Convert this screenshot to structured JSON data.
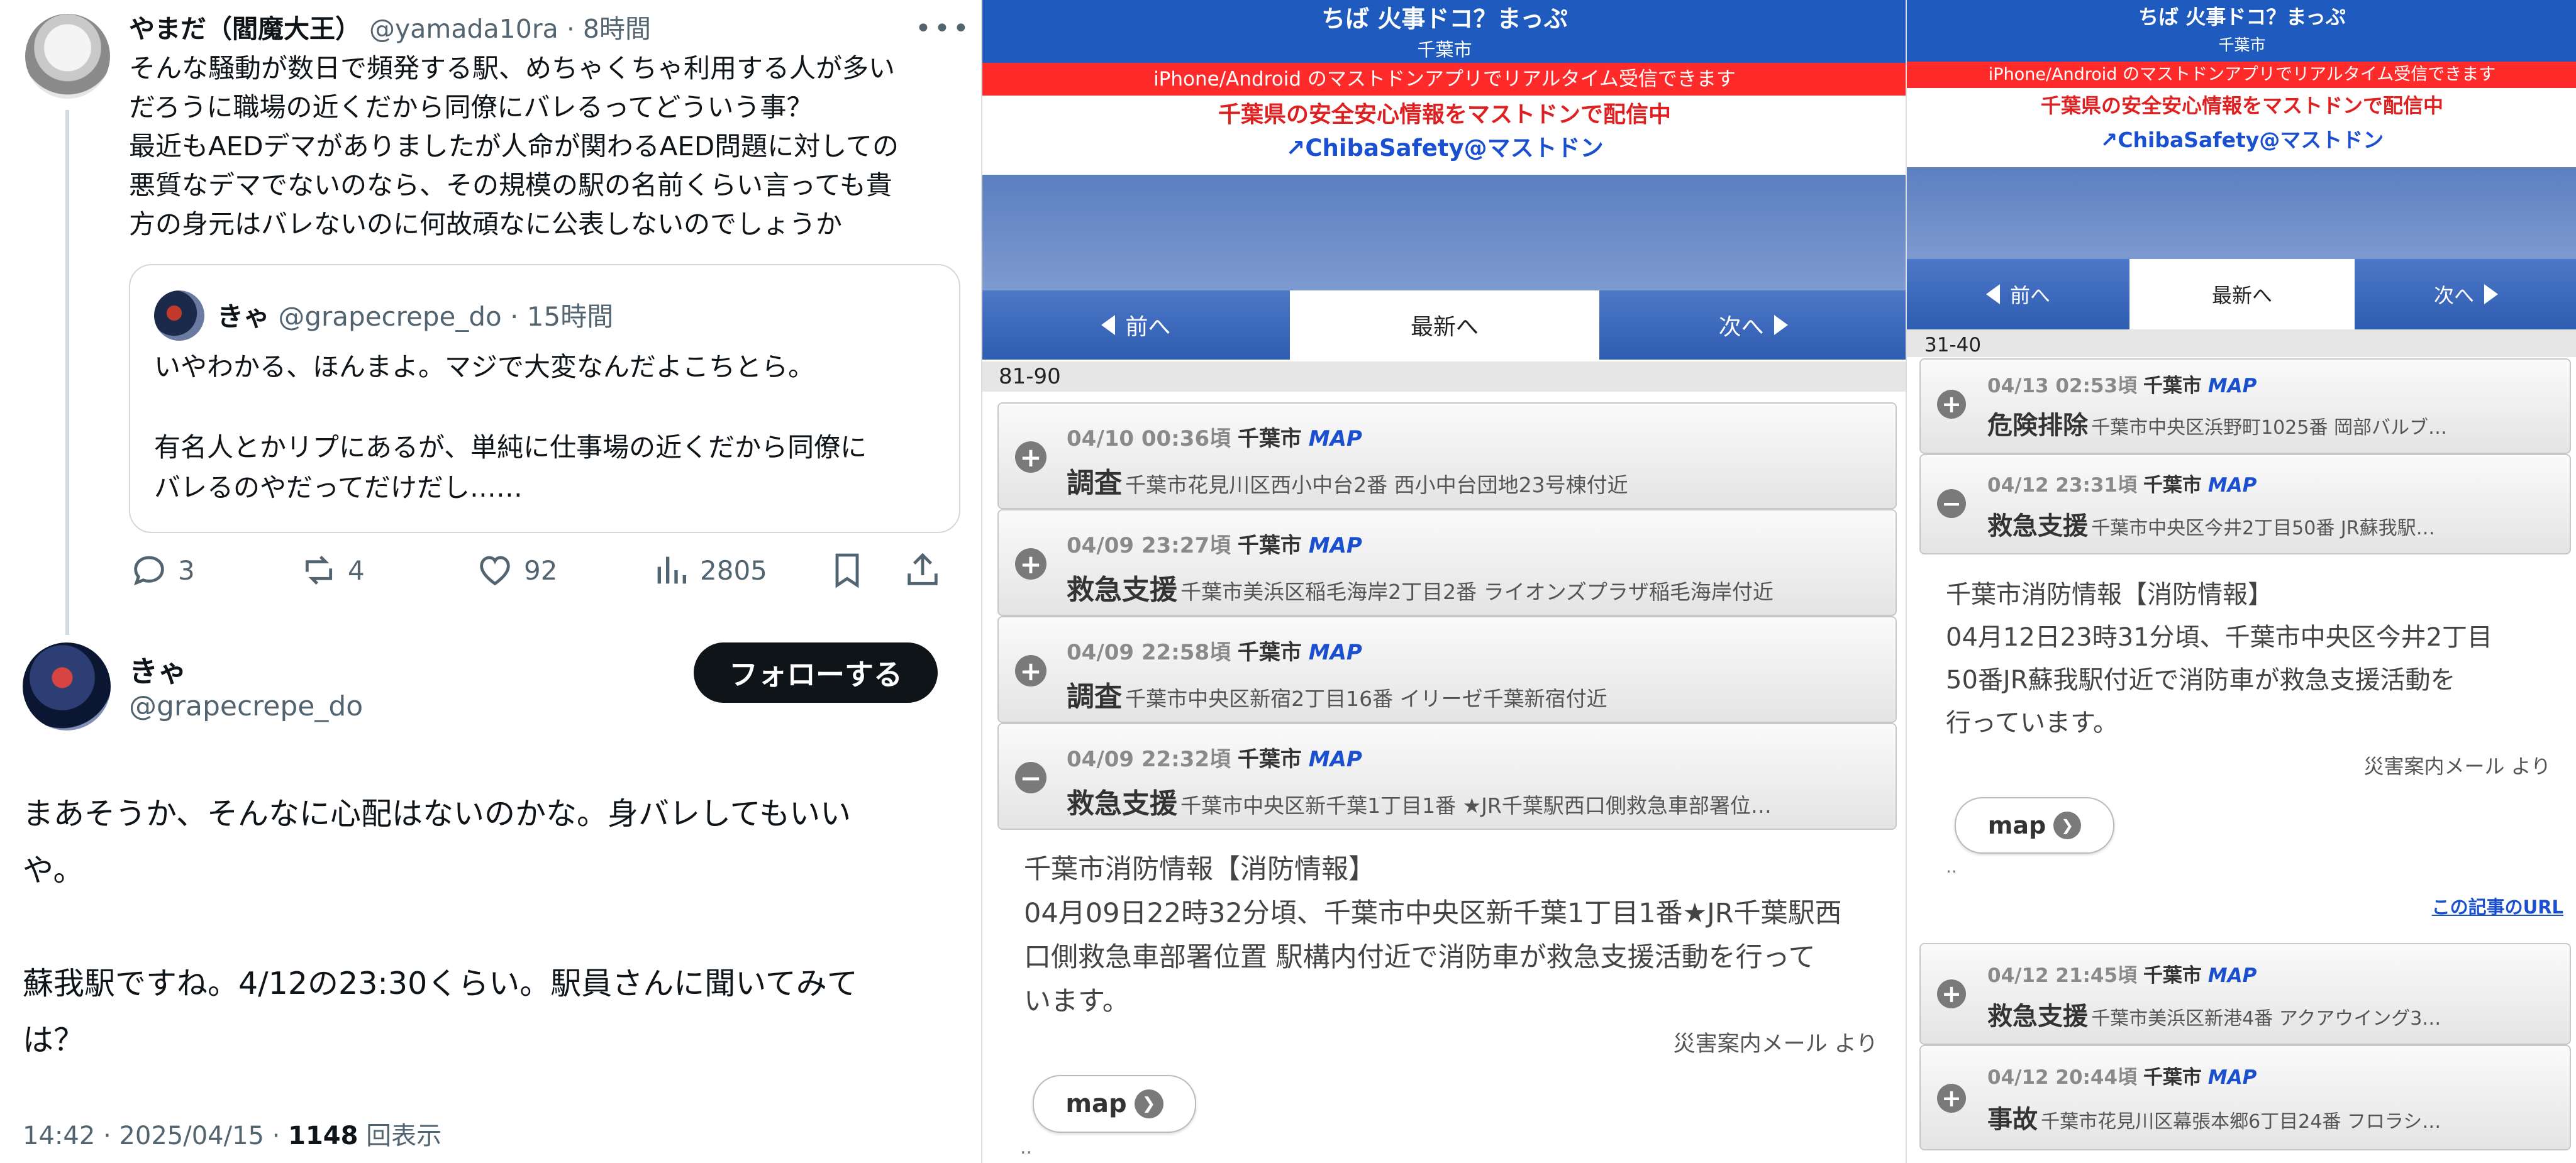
{
  "tweet": {
    "author_name": "やまだ（閻魔大王）",
    "author_handle": "@yamada10ra",
    "time": "8時間",
    "separator": " · ",
    "lines": [
      "そんな騒動が数日で頻発する駅、めちゃくちゃ利用する人が多い",
      "だろうに職場の近くだから同僚にバレるってどういう事？",
      "最近もAEDデマがありましたが人命が関わるAED問題に対しての",
      "悪質なデマでないのなら、その規模の駅の名前くらい言っても貴",
      "方の身元はバレないのに何故頑なに公表しないのでしょうか"
    ],
    "quote": {
      "author_name": "きゃ",
      "author_handle": "@grapecrepe_do",
      "time": "15時間",
      "lines": [
        "いやわかる、ほんまよ。マジで大変なんだよこちとら。",
        "",
        "有名人とかリプにあるが、単純に仕事場の近くだから同僚に",
        "バレるのやだってだけだし……"
      ]
    },
    "actions": {
      "replies": "3",
      "retweets": "4",
      "likes": "92",
      "views": "2805"
    }
  },
  "reply": {
    "author_name": "きゃ",
    "author_handle": "@grapecrepe_do",
    "follow_label": "フォローする",
    "lines": [
      "まあそうか、そんなに心配はないのかな。身バレしてもいい",
      "や。",
      "",
      "蘇我駅ですね。4/12の23:30くらい。駅員さんに聞いてみて",
      "は？"
    ],
    "meta_time": "14:42 · 2025/04/15 · ",
    "meta_views": "1148",
    "meta_views_label": " 回表示"
  },
  "chiba_common": {
    "title": "ちば 火事ドコ？まっぷ",
    "subtitle": "千葉市",
    "banner": "iPhone/Android のマストドンアプリでリアルタイム受信できます",
    "info": "千葉県の安全安心情報をマストドンで配信中",
    "link": "ChibaSafety@マストドン",
    "nav_prev": "前へ",
    "nav_latest": "最新へ",
    "nav_next": "次へ",
    "map_tag": "MAP",
    "map_button": "map",
    "source": "災害案内メール より"
  },
  "chiba_mid": {
    "range": "81-90",
    "items": [
      {
        "date": "04/10 00:36頃",
        "city": "千葉市",
        "type": "調査",
        "addr": "千葉市花見川区西小中台2番 西小中台団地23号棟付近",
        "icon": "+"
      },
      {
        "date": "04/09 23:27頃",
        "city": "千葉市",
        "type": "救急支援",
        "addr": "千葉市美浜区稲毛海岸2丁目2番 ライオンズプラザ稲毛海岸付近",
        "icon": "+"
      },
      {
        "date": "04/09 22:58頃",
        "city": "千葉市",
        "type": "調査",
        "addr": "千葉市中央区新宿2丁目16番 イリーゼ千葉新宿付近",
        "icon": "+"
      },
      {
        "date": "04/09 22:32頃",
        "city": "千葉市",
        "type": "救急支援",
        "addr": "千葉市中央区新千葉1丁目1番 ★JR千葉駅西口側救急車部署位…",
        "icon": "−"
      }
    ],
    "detail_lines": [
      "千葉市消防情報【消防情報】",
      "04月09日22時32分頃、千葉市中央区新千葉1丁目1番★JR千葉駅西",
      "口側救急車部署位置 駅構内付近で消防車が救急支援活動を行って",
      "います。"
    ],
    "dots": ".."
  },
  "chiba_right": {
    "range": "31-40",
    "items_top": [
      {
        "date": "04/13 02:53頃",
        "city": "千葉市",
        "type": "危険排除",
        "addr": "千葉市中央区浜野町1025番 岡部バルブ…",
        "icon": "+"
      },
      {
        "date": "04/12 23:31頃",
        "city": "千葉市",
        "type": "救急支援",
        "addr": "千葉市中央区今井2丁目50番 JR蘇我駅…",
        "icon": "−"
      }
    ],
    "detail_lines": [
      "千葉市消防情報【消防情報】",
      "04月12日23時31分頃、千葉市中央区今井2丁目",
      "50番JR蘇我駅付近で消防車が救急支援活動を",
      "行っています。"
    ],
    "dots": "..",
    "url_label": "この記事のURL",
    "items_bottom": [
      {
        "date": "04/12 21:45頃",
        "city": "千葉市",
        "type": "救急支援",
        "addr": "千葉市美浜区新港4番 アクアウイング3…",
        "icon": "+"
      },
      {
        "date": "04/12 20:44頃",
        "city": "千葉市",
        "type": "事故",
        "addr": "千葉市花見川区幕張本郷6丁目24番 フロラシ…",
        "icon": "+"
      }
    ]
  }
}
